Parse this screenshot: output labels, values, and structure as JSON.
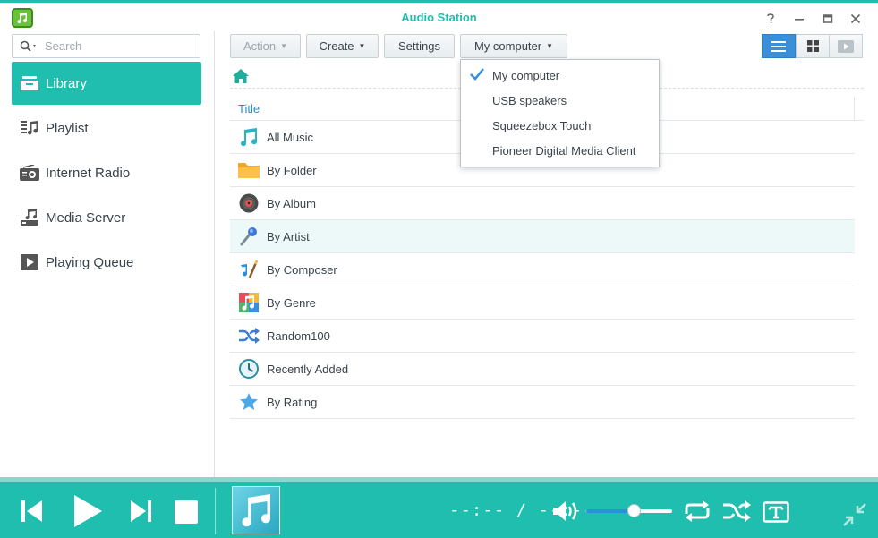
{
  "window": {
    "title": "Audio Station",
    "controls": [
      "help-icon",
      "minimize-icon",
      "maximize-icon",
      "close-icon"
    ]
  },
  "search": {
    "placeholder": "Search"
  },
  "sidebar": {
    "items": [
      {
        "label": "Library",
        "icon": "library-icon",
        "active": true
      },
      {
        "label": "Playlist",
        "icon": "playlist-icon"
      },
      {
        "label": "Internet Radio",
        "icon": "radio-icon"
      },
      {
        "label": "Media Server",
        "icon": "media-server-icon"
      },
      {
        "label": "Playing Queue",
        "icon": "playing-queue-icon"
      }
    ]
  },
  "toolbar": {
    "action_label": "Action",
    "create_label": "Create",
    "settings_label": "Settings",
    "output_label": "My computer",
    "views": [
      "list-view-icon",
      "grid-view-icon",
      "video-view-icon"
    ]
  },
  "list": {
    "column_title": "Title",
    "rows": [
      {
        "label": "All Music",
        "icon": "music-note-icon"
      },
      {
        "label": "By Folder",
        "icon": "folder-icon"
      },
      {
        "label": "By Album",
        "icon": "album-icon"
      },
      {
        "label": "By Artist",
        "icon": "microphone-icon"
      },
      {
        "label": "By Composer",
        "icon": "composer-icon"
      },
      {
        "label": "By Genre",
        "icon": "genre-icon"
      },
      {
        "label": "Random100",
        "icon": "shuffle-icon"
      },
      {
        "label": "Recently Added",
        "icon": "clock-icon"
      },
      {
        "label": "By Rating",
        "icon": "star-icon"
      }
    ]
  },
  "dropdown": {
    "items": [
      {
        "label": "My computer",
        "checked": true
      },
      {
        "label": "USB speakers"
      },
      {
        "label": "Squeezebox Touch"
      },
      {
        "label": "Pioneer Digital Media Client"
      }
    ]
  },
  "player": {
    "time": "--:-- / --:--",
    "volume": 0.55,
    "colors": {
      "bar": "#1fbeae",
      "accent": "#2b8fe0"
    }
  }
}
